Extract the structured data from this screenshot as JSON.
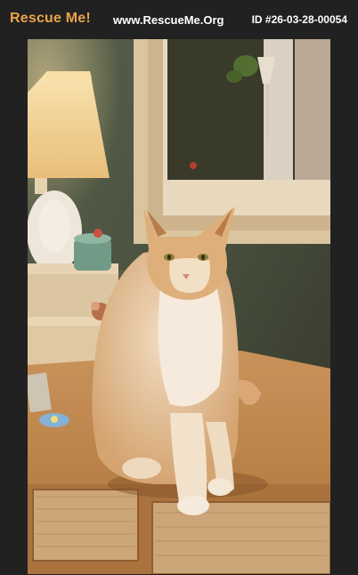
{
  "header": {
    "brand": "Rescue Me!",
    "site_url": "www.RescueMe.Org",
    "listing_id": "ID #26-03-28-00054"
  },
  "photo": {
    "subject": "cat-photo"
  },
  "colors": {
    "background": "#212121",
    "brand": "#e9a34a",
    "text": "#ffffff"
  }
}
